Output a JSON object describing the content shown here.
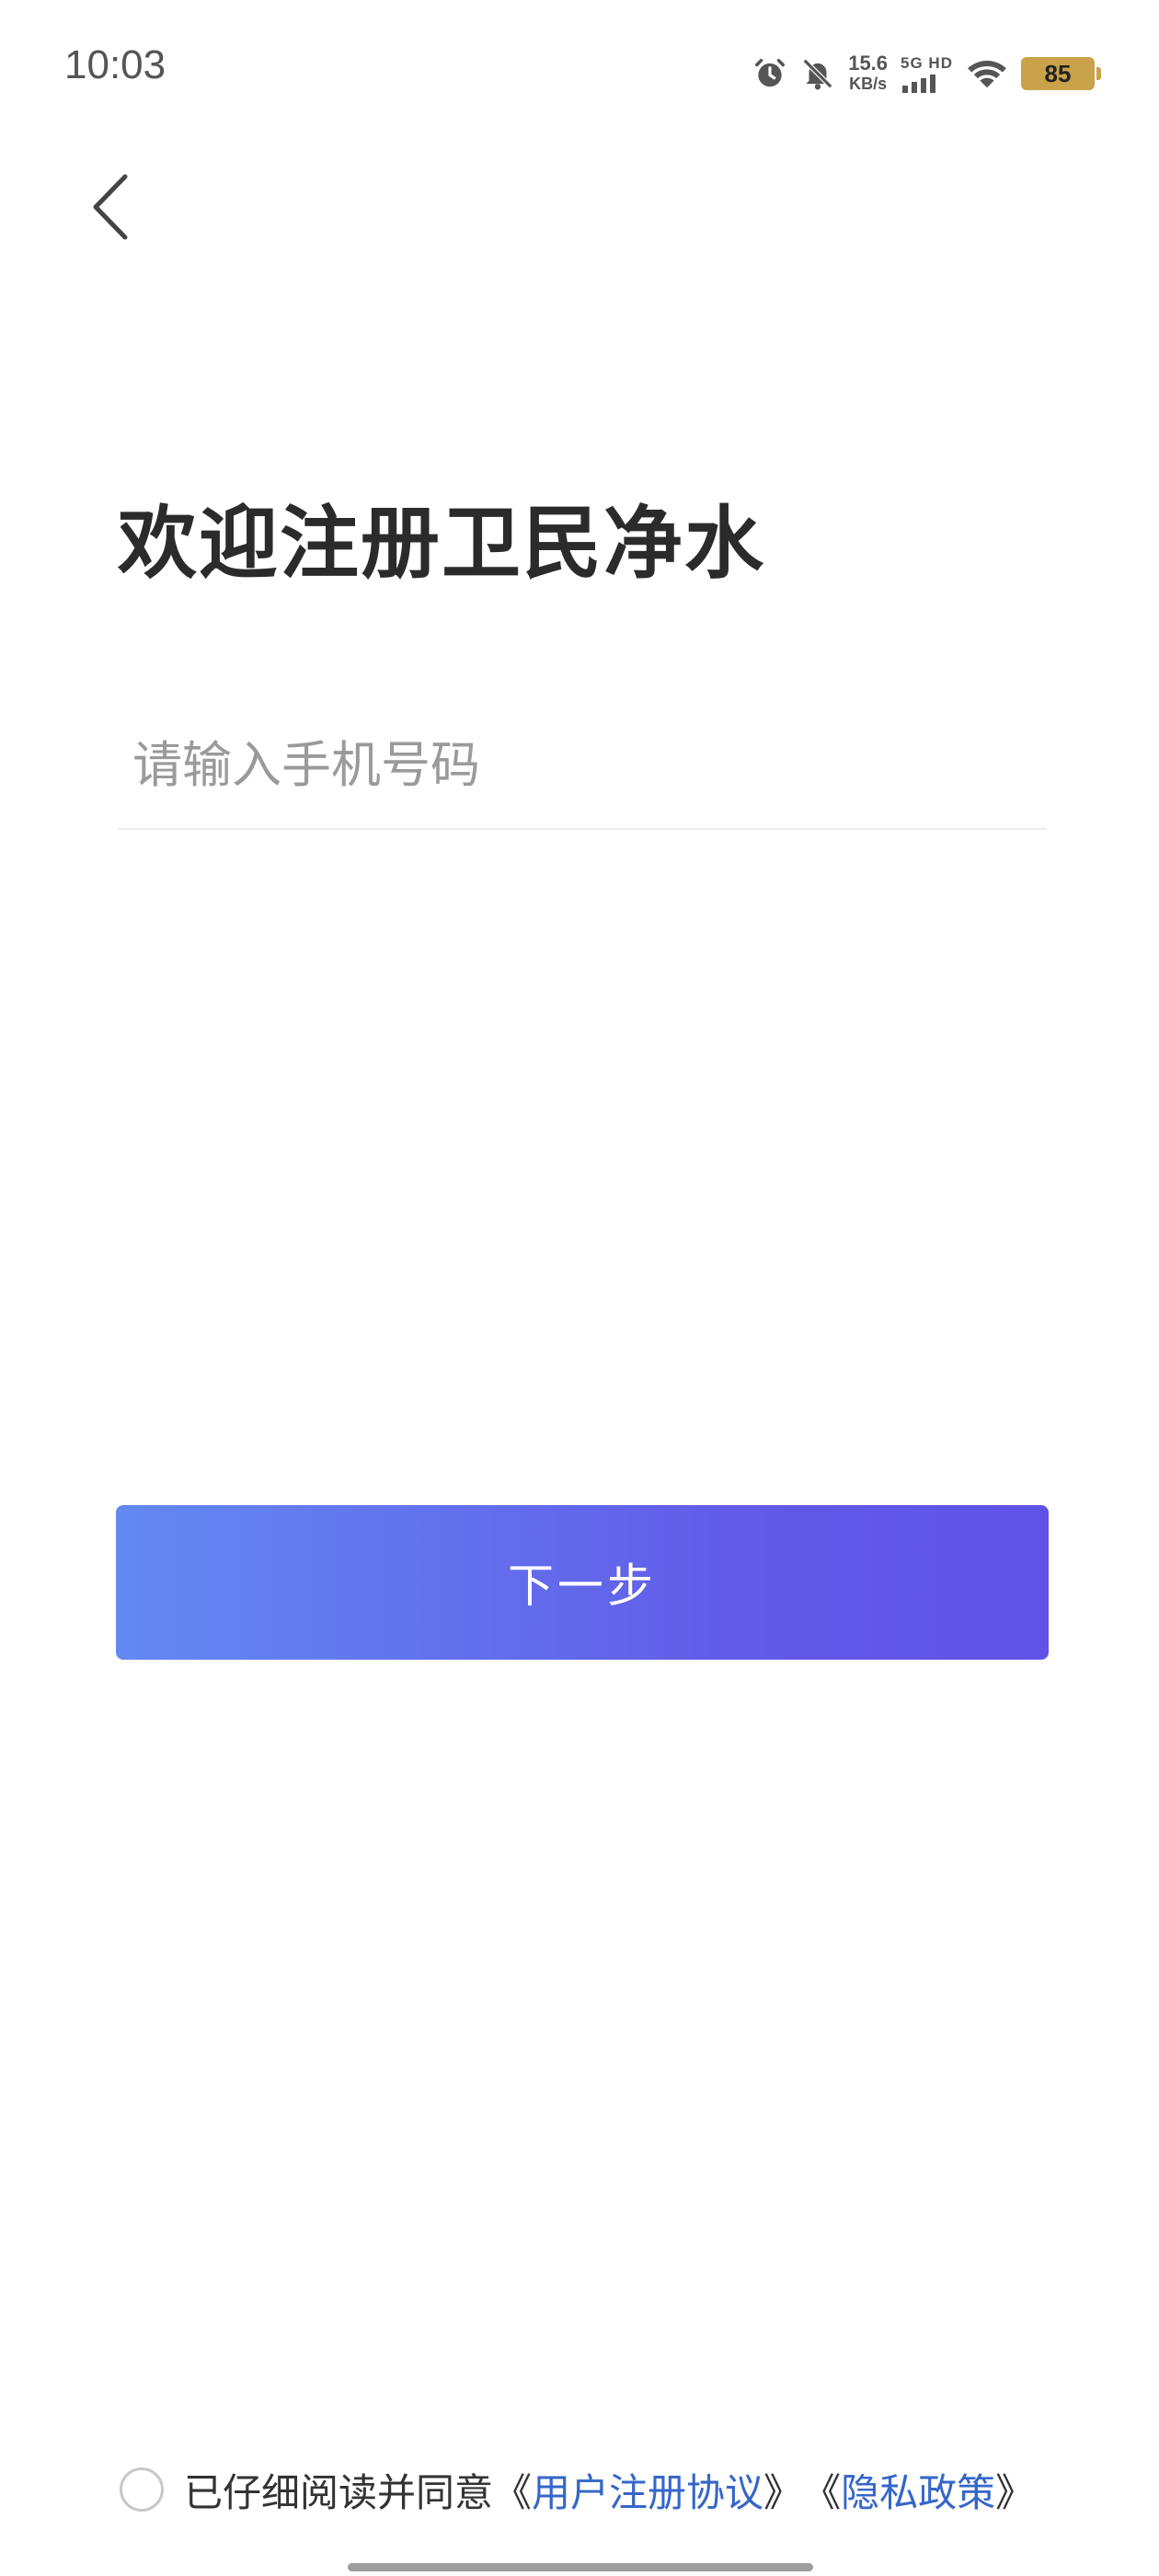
{
  "status_bar": {
    "time": "10:03",
    "speed_value": "15.6",
    "speed_unit": "KB/s",
    "network_label": "5G HD",
    "battery_level": "85",
    "icons": [
      "alarm-icon",
      "mute-bell-icon",
      "signal-icon",
      "wifi-icon",
      "battery-icon"
    ],
    "battery_color": "#c9a24a"
  },
  "nav": {
    "back_icon": "chevron-left-icon"
  },
  "title": "欢迎注册卫民净水",
  "phone": {
    "placeholder": "请输入手机号码",
    "value": ""
  },
  "next_button": {
    "label": "下一步",
    "gradient_start": "#6389f1",
    "gradient_end": "#5f52e6"
  },
  "agreement": {
    "prefix": "已仔细阅读并同意",
    "open_bracket": "《",
    "close_bracket": "》",
    "user_agreement": "用户注册协议",
    "privacy_policy": "隐私政策",
    "link_color": "#3566c9"
  }
}
